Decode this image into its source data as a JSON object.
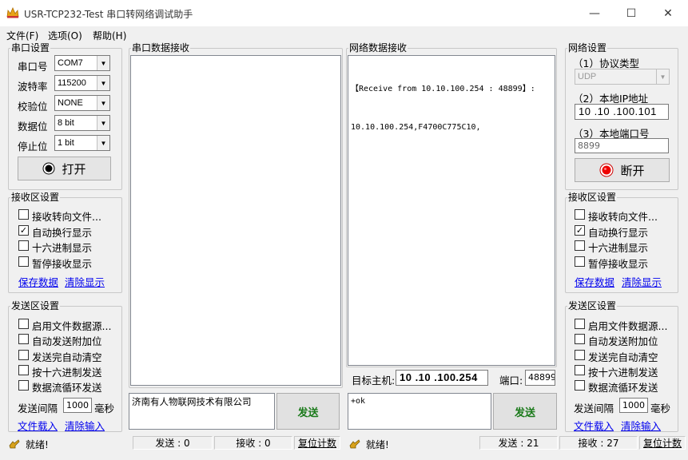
{
  "window": {
    "title": "USR-TCP232-Test 串口转网络调试助手",
    "controls": {
      "minimize": "—",
      "maximize": "☐",
      "close": "✕"
    }
  },
  "menu": [
    {
      "label": "文件(F)"
    },
    {
      "label": "选项(O)"
    },
    {
      "label": "帮助(H)"
    }
  ],
  "serial_settings": {
    "title": "串口设置",
    "port": {
      "label": "串口号",
      "value": "COM7"
    },
    "baud": {
      "label": "波特率",
      "value": "115200"
    },
    "parity": {
      "label": "校验位",
      "value": "NONE"
    },
    "data_bits": {
      "label": "数据位",
      "value": "8 bit"
    },
    "stop_bits": {
      "label": "停止位",
      "value": "1 bit"
    },
    "open_button": "打开"
  },
  "left_receive_settings": {
    "title": "接收区设置",
    "options": [
      {
        "label": "接收转向文件...",
        "checked": false
      },
      {
        "label": "自动换行显示",
        "checked": true
      },
      {
        "label": "十六进制显示",
        "checked": false
      },
      {
        "label": "暂停接收显示",
        "checked": false
      }
    ],
    "save_link": "保存数据",
    "clear_link": "清除显示"
  },
  "left_send_settings": {
    "title": "发送区设置",
    "options": [
      {
        "label": "启用文件数据源...",
        "checked": false
      },
      {
        "label": "自动发送附加位",
        "checked": false
      },
      {
        "label": "发送完自动清空",
        "checked": false
      },
      {
        "label": "按十六进制发送",
        "checked": false
      },
      {
        "label": "数据流循环发送",
        "checked": false
      }
    ],
    "interval_label": "发送间隔",
    "interval_value": "1000",
    "interval_unit": "毫秒",
    "load_link": "文件载入",
    "clear_link": "清除输入"
  },
  "serial_receive": {
    "title": "串口数据接收",
    "content": ""
  },
  "serial_send": {
    "content": "济南有人物联网技术有限公司",
    "send_button": "发送"
  },
  "network_receive": {
    "title": "网络数据接收",
    "line1": "【Receive from 10.10.100.254 : 48899】:",
    "line2": "10.10.100.254,F4700C775C10,"
  },
  "network_target": {
    "host_label": "目标主机:",
    "host_value": "10 .10 .100.254",
    "port_label": "端口:",
    "port_value": "48899"
  },
  "network_send": {
    "content": "+ok",
    "send_button": "发送"
  },
  "network_settings": {
    "title": "网络设置",
    "protocol_label": "（1）协议类型",
    "protocol_value": "UDP",
    "local_ip_label": "（2）本地IP地址",
    "local_ip_value": "10 .10 .100.101",
    "local_port_label": "（3）本地端口号",
    "local_port_value": "8899",
    "disconnect_button": "断开"
  },
  "right_receive_settings": {
    "title": "接收区设置",
    "options": [
      {
        "label": "接收转向文件...",
        "checked": false
      },
      {
        "label": "自动换行显示",
        "checked": true
      },
      {
        "label": "十六进制显示",
        "checked": false
      },
      {
        "label": "暂停接收显示",
        "checked": false
      }
    ],
    "save_link": "保存数据",
    "clear_link": "清除显示"
  },
  "right_send_settings": {
    "title": "发送区设置",
    "options": [
      {
        "label": "启用文件数据源...",
        "checked": false
      },
      {
        "label": "自动发送附加位",
        "checked": false
      },
      {
        "label": "发送完自动清空",
        "checked": false
      },
      {
        "label": "按十六进制发送",
        "checked": false
      },
      {
        "label": "数据流循环发送",
        "checked": false
      }
    ],
    "interval_label": "发送间隔",
    "interval_value": "1000",
    "interval_unit": "毫秒",
    "load_link": "文件载入",
    "clear_link": "清除输入"
  },
  "status_left": {
    "ready": "就绪!",
    "sent": "发送 : 0",
    "received": "接收 : 0",
    "reset": "复位计数"
  },
  "status_right": {
    "ready": "就绪!",
    "sent": "发送 : 21",
    "received": "接收 : 27",
    "reset": "复位计数"
  }
}
